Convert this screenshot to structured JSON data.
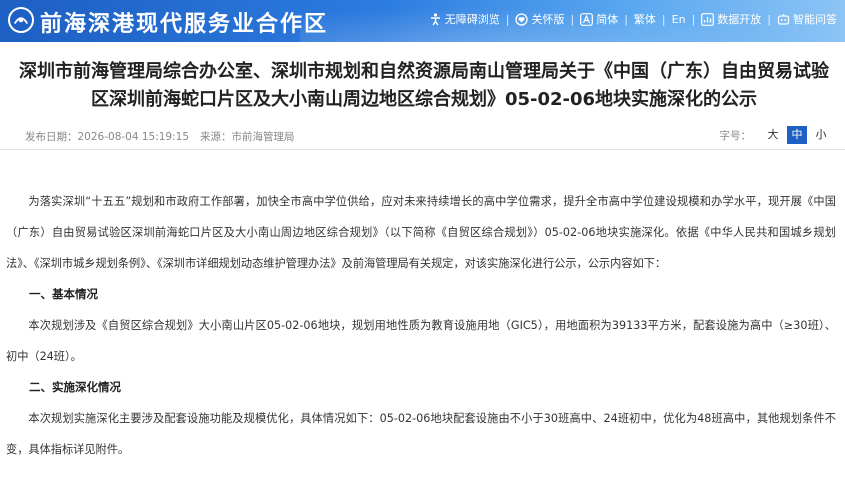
{
  "header": {
    "site_name": "前海深港现代服务业合作区",
    "tools": [
      {
        "label": "无障碍浏览",
        "icon": "accessibility-icon"
      },
      {
        "label": "关怀版",
        "icon": "care-icon"
      },
      {
        "label": "简体",
        "icon": "font-icon"
      },
      {
        "label": "繁体"
      },
      {
        "label": "En"
      },
      {
        "label": "数据开放",
        "icon": "data-icon"
      },
      {
        "label": "智能问答",
        "icon": "chat-robot-icon"
      }
    ]
  },
  "article": {
    "title": "深圳市前海管理局综合办公室、深圳市规划和自然资源局南山管理局关于《中国（广东）自由贸易试验区深圳前海蛇口片区及大小南山周边地区综合规划》05-02-06地块实施深化的公示",
    "publish_date": "发布日期：2026-08-04 15:19:15",
    "source": "来源：市前海管理局",
    "font_size_label": "字号：",
    "font_sizes": [
      "大",
      "中",
      "小"
    ],
    "font_size_selected": "中",
    "intro": "为落实深圳“十五五”规划和市政府工作部署，加快全市高中学位供给，应对未来持续增长的高中学位需求，提升全市高中学位建设规模和办学水平，现开展《中国（广东）自由贸易试验区深圳前海蛇口片区及大小南山周边地区综合规划》（以下简称《自贸区综合规划》）05-02-06地块实施深化。依据《中华人民共和国城乡规划法》、《深圳市城乡规划条例》、《深圳市详细规划动态维护管理办法》及前海管理局有关规定，对该实施深化进行公示，公示内容如下：",
    "section1_heading": "一、基本情况",
    "section1_text": "本次规划涉及《自贸区综合规划》大小南山片区05-02-06地块，规划用地性质为教育设施用地（GIC5），用地面积为39133平方米，配套设施为高中（≥30班）、初中（24班）。",
    "section2_heading": "二、实施深化情况",
    "section2_text": "本次规划实施深化主要涉及配套设施功能及规模优化，具体情况如下：05-02-06地块配套设施由不小于30班高中、24班初中，优化为48班高中，其他规划条件不变，具体指标详见附件。"
  },
  "colors": {
    "brand_blue": "#1d5fc2",
    "header_light": "#8cc4f5"
  }
}
